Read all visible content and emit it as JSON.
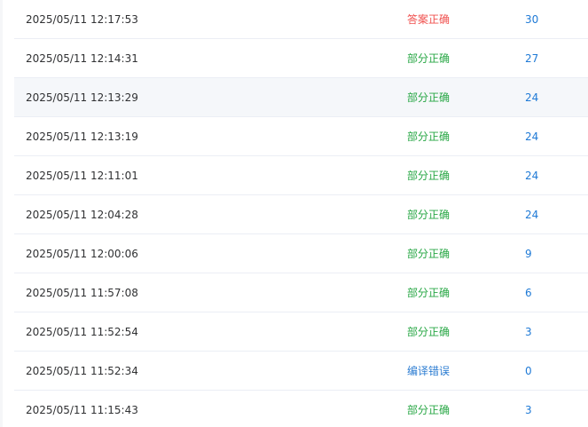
{
  "submissions": [
    {
      "time": "2025/05/11 12:17:53",
      "status": "答案正确",
      "status_kind": "red",
      "score": "30"
    },
    {
      "time": "2025/05/11 12:14:31",
      "status": "部分正确",
      "status_kind": "green",
      "score": "27"
    },
    {
      "time": "2025/05/11 12:13:29",
      "status": "部分正确",
      "status_kind": "green",
      "score": "24"
    },
    {
      "time": "2025/05/11 12:13:19",
      "status": "部分正确",
      "status_kind": "green",
      "score": "24"
    },
    {
      "time": "2025/05/11 12:11:01",
      "status": "部分正确",
      "status_kind": "green",
      "score": "24"
    },
    {
      "time": "2025/05/11 12:04:28",
      "status": "部分正确",
      "status_kind": "green",
      "score": "24"
    },
    {
      "time": "2025/05/11 12:00:06",
      "status": "部分正确",
      "status_kind": "green",
      "score": "9"
    },
    {
      "time": "2025/05/11 11:57:08",
      "status": "部分正确",
      "status_kind": "green",
      "score": "6"
    },
    {
      "time": "2025/05/11 11:52:54",
      "status": "部分正确",
      "status_kind": "green",
      "score": "3"
    },
    {
      "time": "2025/05/11 11:52:34",
      "status": "编译错误",
      "status_kind": "blue",
      "score": "0"
    },
    {
      "time": "2025/05/11 11:15:43",
      "status": "部分正确",
      "status_kind": "green",
      "score": "3"
    }
  ],
  "colors": {
    "correct": "#f0504e",
    "partial": "#28a745",
    "compile_error": "#2d7dd2",
    "score": "#1f7ad6"
  }
}
